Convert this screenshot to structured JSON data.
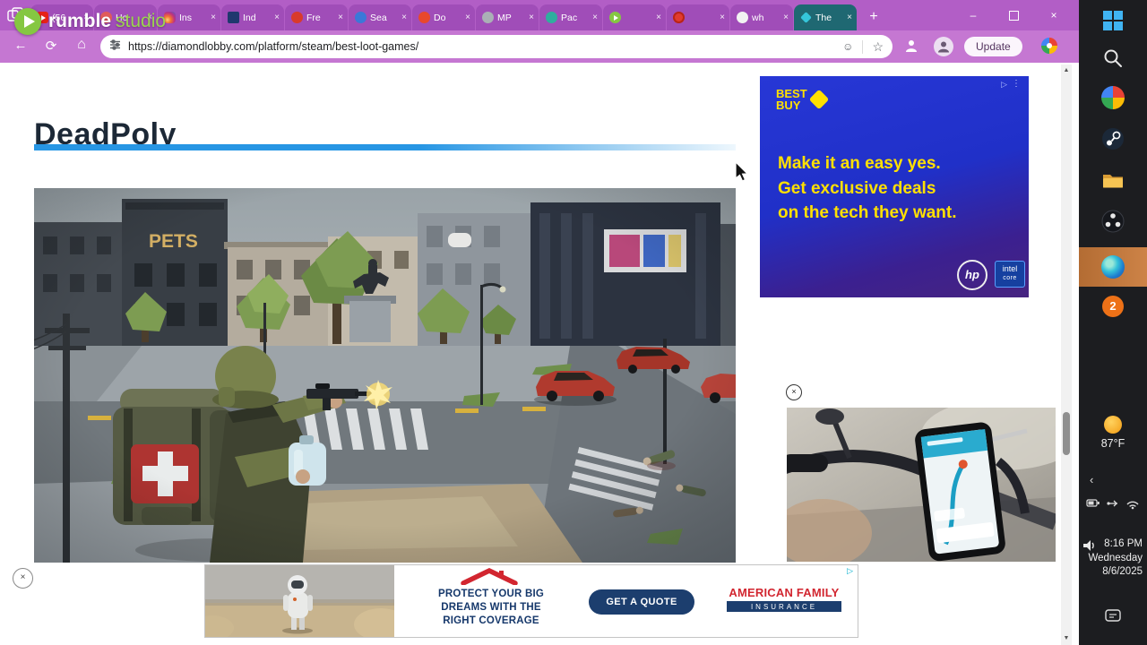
{
  "colors": {
    "titlebar": "#b25ec6",
    "tab_inactive": "#a04db8",
    "tab_active": "#1f6872",
    "navbar": "#c577d2",
    "accent_underline": "#2796e4",
    "bestbuy_yellow": "#ffe000",
    "amfam_red": "#d22630",
    "amfam_navy": "#1c3e6e",
    "taskbar_bg": "#1c1d20",
    "edge_highlight_orange": "#c0763c"
  },
  "glyphs": {
    "close": "×",
    "plus": "+",
    "minimize": "–",
    "back": "←",
    "refresh": "⟳",
    "home": "⌂",
    "star": "☆",
    "smiley": "☺",
    "scroll_up": "▲",
    "scroll_down": "▼",
    "adchoices": "▷",
    "menu_dots": "⋮",
    "chevron": "‹"
  },
  "overlay": {
    "brand_bold": "rumble",
    "brand_light": "studio"
  },
  "tabs": [
    {
      "label": "(56"
    },
    {
      "label": "Ho"
    },
    {
      "label": "Ins"
    },
    {
      "label": "Ind"
    },
    {
      "label": "Fre"
    },
    {
      "label": "Sea"
    },
    {
      "label": "Do"
    },
    {
      "label": "MP"
    },
    {
      "label": "Pac"
    },
    {
      "label": ""
    },
    {
      "label": ""
    },
    {
      "label": "wh"
    },
    {
      "label": "The"
    }
  ],
  "navbar": {
    "url": "https://diamondlobby.com/platform/steam/best-loot-games/",
    "update_label": "Update"
  },
  "article": {
    "heading": "DeadPoly",
    "building_sign": "PETS"
  },
  "ads": {
    "bestbuy": {
      "brand_top": "BEST",
      "brand_bottom": "BUY",
      "line1": "Make it an easy yes.",
      "line2": "Get exclusive deals",
      "line3": "on the tech they want.",
      "hp": "hp",
      "intel_line1": "intel",
      "intel_line2": "core"
    },
    "banner": {
      "line1": "PROTECT YOUR BIG",
      "line2": "DREAMS WITH THE",
      "line3": "RIGHT COVERAGE",
      "cta": "GET A QUOTE",
      "brand_top": "AMERICAN FAMILY",
      "brand_bottom": "INSURANCE"
    }
  },
  "taskbar": {
    "weather_temp": "87°F",
    "badge_count": "2",
    "time": "8:16 PM",
    "day": "Wednesday",
    "date": "8/6/2025"
  }
}
